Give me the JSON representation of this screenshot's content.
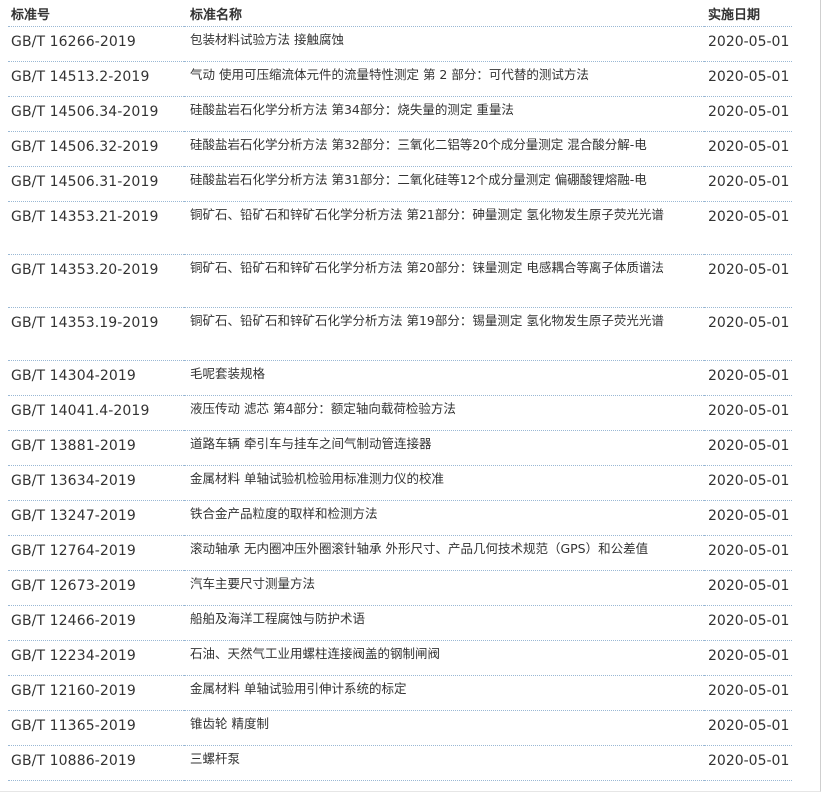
{
  "table": {
    "headers": {
      "code": "标准号",
      "name": "标准名称",
      "date": "实施日期"
    },
    "rows": [
      {
        "code": "GB/T 16266-2019",
        "name": "包装材料试验方法 接触腐蚀",
        "date": "2020-05-01"
      },
      {
        "code": "GB/T 14513.2-2019",
        "name": "气动 使用可压缩流体元件的流量特性测定 第 2 部分：可代替的测试方法",
        "date": "2020-05-01"
      },
      {
        "code": "GB/T 14506.34-2019",
        "name": "硅酸盐岩石化学分析方法 第34部分：烧失量的测定 重量法",
        "date": "2020-05-01"
      },
      {
        "code": "GB/T 14506.32-2019",
        "name": "硅酸盐岩石化学分析方法 第32部分：三氧化二铝等20个成分量测定 混合酸分解-电",
        "date": "2020-05-01"
      },
      {
        "code": "GB/T 14506.31-2019",
        "name": "硅酸盐岩石化学分析方法 第31部分：二氧化硅等12个成分量测定 偏硼酸锂熔融-电",
        "date": "2020-05-01"
      },
      {
        "code": "GB/T 14353.21-2019",
        "name": "铜矿石、铅矿石和锌矿石化学分析方法 第21部分：砷量测定 氢化物发生原子荧光光谱",
        "date": "2020-05-01"
      },
      {
        "code": "GB/T 14353.20-2019",
        "name": "铜矿石、铅矿石和锌矿石化学分析方法 第20部分：铼量测定 电感耦合等离子体质谱法",
        "date": "2020-05-01"
      },
      {
        "code": "GB/T 14353.19-2019",
        "name": "铜矿石、铅矿石和锌矿石化学分析方法 第19部分：锡量测定 氢化物发生原子荧光光谱",
        "date": "2020-05-01"
      },
      {
        "code": "GB/T 14304-2019",
        "name": "毛呢套装规格",
        "date": "2020-05-01"
      },
      {
        "code": "GB/T 14041.4-2019",
        "name": "液压传动 滤芯 第4部分：额定轴向载荷检验方法",
        "date": "2020-05-01"
      },
      {
        "code": "GB/T 13881-2019",
        "name": "道路车辆 牵引车与挂车之间气制动管连接器",
        "date": "2020-05-01"
      },
      {
        "code": "GB/T 13634-2019",
        "name": "金属材料 单轴试验机检验用标准测力仪的校准",
        "date": "2020-05-01"
      },
      {
        "code": "GB/T 13247-2019",
        "name": "铁合金产品粒度的取样和检测方法",
        "date": "2020-05-01"
      },
      {
        "code": "GB/T 12764-2019",
        "name": "滚动轴承 无内圈冲压外圈滚针轴承 外形尺寸、产品几何技术规范（GPS）和公差值",
        "date": "2020-05-01"
      },
      {
        "code": "GB/T 12673-2019",
        "name": "汽车主要尺寸测量方法",
        "date": "2020-05-01"
      },
      {
        "code": "GB/T 12466-2019",
        "name": "船舶及海洋工程腐蚀与防护术语",
        "date": "2020-05-01"
      },
      {
        "code": "GB/T 12234-2019",
        "name": "石油、天然气工业用螺柱连接阀盖的钢制闸阀",
        "date": "2020-05-01"
      },
      {
        "code": "GB/T 12160-2019",
        "name": "金属材料 单轴试验用引伸计系统的标定",
        "date": "2020-05-01"
      },
      {
        "code": "GB/T 11365-2019",
        "name": "锥齿轮 精度制",
        "date": "2020-05-01"
      },
      {
        "code": "GB/T 10886-2019",
        "name": "三螺杆泵",
        "date": "2020-05-01"
      }
    ]
  }
}
